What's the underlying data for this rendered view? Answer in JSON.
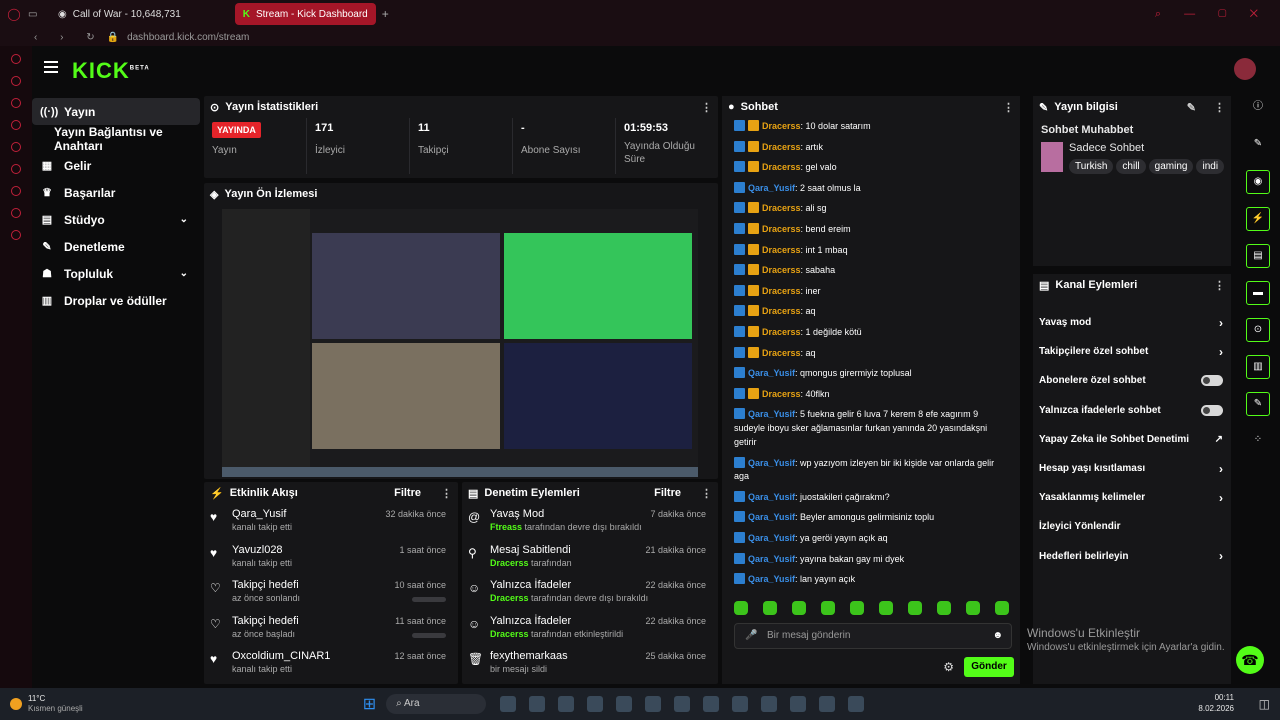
{
  "browser": {
    "tabs": [
      {
        "label": "Call of War - 10,648,731"
      },
      {
        "label": "Stream - Kick Dashboard"
      }
    ],
    "url": "dashboard.kick.com/stream"
  },
  "brand": {
    "logo": "KICK",
    "beta": "BETA"
  },
  "nav": {
    "items": [
      {
        "label": "Yayın",
        "icon": "broadcast-icon"
      },
      {
        "label": "Yayın Bağlantısı ve Anahtarı"
      },
      {
        "label": "Gelir",
        "icon": "money-icon"
      },
      {
        "label": "Başarılar",
        "icon": "trophy-icon"
      },
      {
        "label": "Stüdyo",
        "icon": "studio-icon"
      },
      {
        "label": "Denetleme",
        "icon": "wrench-icon"
      },
      {
        "label": "Topluluk",
        "icon": "community-icon"
      },
      {
        "label": "Droplar ve ödüller",
        "icon": "gift-icon"
      }
    ]
  },
  "stats": {
    "title": "Yayın İstatistikleri",
    "badge": "YAYINDA",
    "items": [
      {
        "value": "",
        "label": "Yayın"
      },
      {
        "value": "171",
        "label": "İzleyici"
      },
      {
        "value": "11",
        "label": "Takipçi"
      },
      {
        "value": "-",
        "label": "Abone Sayısı"
      },
      {
        "value": "01:59:53",
        "label": "Yayında Olduğu Süre"
      }
    ]
  },
  "preview": {
    "title": "Yayın Ön İzlemesi"
  },
  "activity": {
    "title": "Etkinlik Akışı",
    "filter": "Filtre",
    "items": [
      {
        "title": "Qara_Yusif",
        "sub": "kanalı takip etti",
        "time": "32 dakika önce"
      },
      {
        "title": "Yavuzl028",
        "sub": "kanalı takip etti",
        "time": "1 saat önce"
      },
      {
        "title": "Takipçi hedefi",
        "sub": "az önce sonlandı",
        "time": "10 saat önce"
      },
      {
        "title": "Takipçi hedefi",
        "sub": "az önce başladı",
        "time": "11 saat önce"
      },
      {
        "title": "Oxcoldium_CINAR1",
        "sub": "kanalı takip etti",
        "time": "12 saat önce"
      }
    ]
  },
  "moderation": {
    "title": "Denetim Eylemleri",
    "filter": "Filtre",
    "items": [
      {
        "title": "Yavaş Mod",
        "actor": "Ftreass",
        "sub": "tarafından devre dışı bırakıldı",
        "time": "7 dakika önce"
      },
      {
        "title": "Mesaj Sabitlendi",
        "actor": "Dracerss",
        "sub": "tarafından",
        "time": "21 dakika önce"
      },
      {
        "title": "Yalnızca İfadeler",
        "actor": "Dracerss",
        "sub": "tarafından devre dışı bırakıldı",
        "time": "22 dakika önce"
      },
      {
        "title": "Yalnızca İfadeler",
        "actor": "Dracerss",
        "sub": "tarafından etkinleştirildi",
        "time": "22 dakika önce"
      },
      {
        "title": "fexythemarkaas",
        "actor": "",
        "sub": "bir mesajı sildi",
        "time": "25 dakika önce"
      }
    ]
  },
  "chat": {
    "title": "Sohbet",
    "placeholder": "Bir mesaj gönderin",
    "send": "Gönder",
    "messages": [
      {
        "user": "Dracerss",
        "text": "10 dolar satarım",
        "mod": true
      },
      {
        "user": "Dracerss",
        "text": "artık",
        "mod": true
      },
      {
        "user": "Dracerss",
        "text": "gel valo",
        "mod": true
      },
      {
        "user": "Qara_Yusif",
        "text": "2 saat olmus la",
        "mod": false
      },
      {
        "user": "Dracerss",
        "text": "ali sg",
        "mod": true
      },
      {
        "user": "Dracerss",
        "text": "bend ereim",
        "mod": true
      },
      {
        "user": "Dracerss",
        "text": "int 1 mbaq",
        "mod": true
      },
      {
        "user": "Dracerss",
        "text": "sabaha",
        "mod": true
      },
      {
        "user": "Dracerss",
        "text": "iner",
        "mod": true
      },
      {
        "user": "Dracerss",
        "text": "aq",
        "mod": true
      },
      {
        "user": "Dracerss",
        "text": "1 değilde kötü",
        "mod": true
      },
      {
        "user": "Dracerss",
        "text": "aq",
        "mod": true
      },
      {
        "user": "Qara_Yusif",
        "text": "qmongus girermiyiz toplusal",
        "mod": false
      },
      {
        "user": "Dracerss",
        "text": "40flkn",
        "mod": true
      },
      {
        "user": "Qara_Yusif",
        "text": "5 fuekna gelir 6 luva 7 kerem 8 efe xagırım 9 sudeyle iboyu sker ağlamasınlar furkan yanında 20 yasındakşni getirir",
        "mod": false
      },
      {
        "user": "Qara_Yusif",
        "text": "wp yazıyom izleyen bir iki kişide var onlarda gelir aga",
        "mod": false
      },
      {
        "user": "Qara_Yusif",
        "text": "juostakileri çağırakmı?",
        "mod": false
      },
      {
        "user": "Qara_Yusif",
        "text": "Beyler amongus gelirmisiniz toplu",
        "mod": false
      },
      {
        "user": "Qara_Yusif",
        "text": "ya geröi yayın açık aq",
        "mod": false
      },
      {
        "user": "Qara_Yusif",
        "text": "yayına bakan gay mi dyek",
        "mod": false
      },
      {
        "user": "Qara_Yusif",
        "text": "lan yayın açık",
        "mod": false
      }
    ]
  },
  "stream_info": {
    "title": "Yayın bilgisi",
    "stream_title": "Sohbet Muhabbet",
    "category": "Sadece Sohbet",
    "tags": [
      "Turkish",
      "chill",
      "gaming",
      "indi"
    ]
  },
  "channel_actions": {
    "title": "Kanal Eylemleri",
    "items": [
      {
        "label": "Yavaş mod",
        "control": "arrow"
      },
      {
        "label": "Takipçilere özel sohbet",
        "control": "arrow"
      },
      {
        "label": "Abonelere özel sohbet",
        "control": "toggle"
      },
      {
        "label": "Yalnızca ifadelerle sohbet",
        "control": "toggle"
      },
      {
        "label": "Yapay Zeka ile Sohbet Denetimi",
        "control": "link"
      },
      {
        "label": "Hesap yaşı kısıtlaması",
        "control": "arrow"
      },
      {
        "label": "Yasaklanmış kelimeler",
        "control": "arrow"
      },
      {
        "label": "İzleyici Yönlendir",
        "control": "none"
      },
      {
        "label": "Hedefleri belirleyin",
        "control": "arrow"
      }
    ]
  },
  "watermark": {
    "line1": "Windows'u Etkinleştir",
    "line2": "Windows'u etkinleştirmek için Ayarlar'a gidin."
  },
  "taskbar": {
    "weather_temp": "11°C",
    "weather_desc": "Kısmen güneşli",
    "search": "Ara",
    "time": "00:11",
    "date": "8.02.2026"
  },
  "colors": {
    "accent": "#53fc18",
    "live": "#e5242a",
    "browser": "#a51628"
  }
}
